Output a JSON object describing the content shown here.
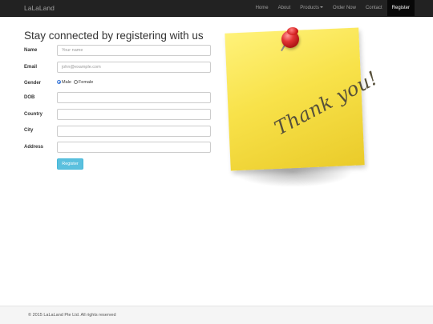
{
  "navbar": {
    "brand": "LaLaLand",
    "items": [
      {
        "label": "Home"
      },
      {
        "label": "About"
      },
      {
        "label": "Products"
      },
      {
        "label": "Order Now"
      },
      {
        "label": "Contact"
      },
      {
        "label": "Register"
      }
    ]
  },
  "form": {
    "heading": "Stay connected by registering with us",
    "name": {
      "label": "Name",
      "placeholder": "Your name"
    },
    "email": {
      "label": "Email",
      "placeholder": "john@example.com"
    },
    "gender": {
      "label": "Gender",
      "options": [
        "Male",
        "Female"
      ],
      "selected": "Male"
    },
    "dob": {
      "label": "DOB",
      "value": ""
    },
    "country": {
      "label": "Country",
      "value": ""
    },
    "city": {
      "label": "City",
      "value": ""
    },
    "address": {
      "label": "Address",
      "value": ""
    },
    "submit_label": "Register"
  },
  "note": {
    "text": "Thank you!"
  },
  "footer": {
    "text": "© 2015 LaLaLand Pte Ltd. All rights reserved"
  },
  "colors": {
    "navbar_bg": "#222222",
    "active_nav_bg": "#080808",
    "button_bg": "#5bc0de",
    "note_yellow": "#f8e24a",
    "pin_red": "#e23434"
  }
}
